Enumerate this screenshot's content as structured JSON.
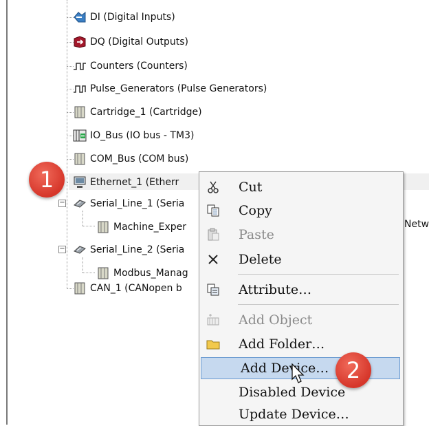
{
  "tree": {
    "items": [
      {
        "label": "DI (Digital Inputs)",
        "icon": "digital-inputs-icon"
      },
      {
        "label": "DQ (Digital Outputs)",
        "icon": "digital-outputs-icon"
      },
      {
        "label": "Counters (Counters)",
        "icon": "counter-pulse-icon"
      },
      {
        "label": "Pulse_Generators (Pulse Generators)",
        "icon": "pulse-generator-icon"
      },
      {
        "label": "Cartridge_1 (Cartridge)",
        "icon": "module-icon"
      },
      {
        "label": "IO_Bus (IO bus - TM3)",
        "icon": "io-bus-icon"
      },
      {
        "label": "COM_Bus (COM bus)",
        "icon": "module-icon"
      },
      {
        "label": "Ethernet_1 (Etherr",
        "icon": "ethernet-icon"
      },
      {
        "label": "Serial_Line_1 (Seria",
        "icon": "serial-line-icon"
      },
      {
        "label": "Machine_Exper",
        "icon": "module-icon"
      },
      {
        "label": "Serial_Line_2 (Seria",
        "icon": "serial-line-icon"
      },
      {
        "label": "Modbus_Manag",
        "icon": "module-icon"
      },
      {
        "label": "CAN_1 (CANopen b",
        "icon": "module-icon"
      }
    ],
    "right_fragment": "Netw"
  },
  "badges": {
    "one": "1",
    "two": "2"
  },
  "context_menu": {
    "items": [
      {
        "label": "Cut",
        "icon": "scissors-icon",
        "enabled": true
      },
      {
        "label": "Copy",
        "icon": "copy-icon",
        "enabled": true
      },
      {
        "label": "Paste",
        "icon": "paste-icon",
        "enabled": false
      },
      {
        "label": "Delete",
        "icon": "delete-x-icon",
        "enabled": true
      },
      {
        "label": "Attribute…",
        "icon": "attribute-icon",
        "enabled": true
      },
      {
        "label": "Add Object",
        "icon": "add-object-icon",
        "enabled": false
      },
      {
        "label": "Add Folder…",
        "icon": "folder-icon",
        "enabled": true
      },
      {
        "label": "Add Device…",
        "icon": "",
        "enabled": true,
        "selected": true
      },
      {
        "label": "Disabled Device",
        "icon": "",
        "enabled": true
      },
      {
        "label": "Update Device…",
        "icon": "",
        "enabled": true
      }
    ]
  },
  "colors": {
    "badge": "#d6362a",
    "selection": "#c6d9ef",
    "selection_border": "#6b9bd1"
  }
}
